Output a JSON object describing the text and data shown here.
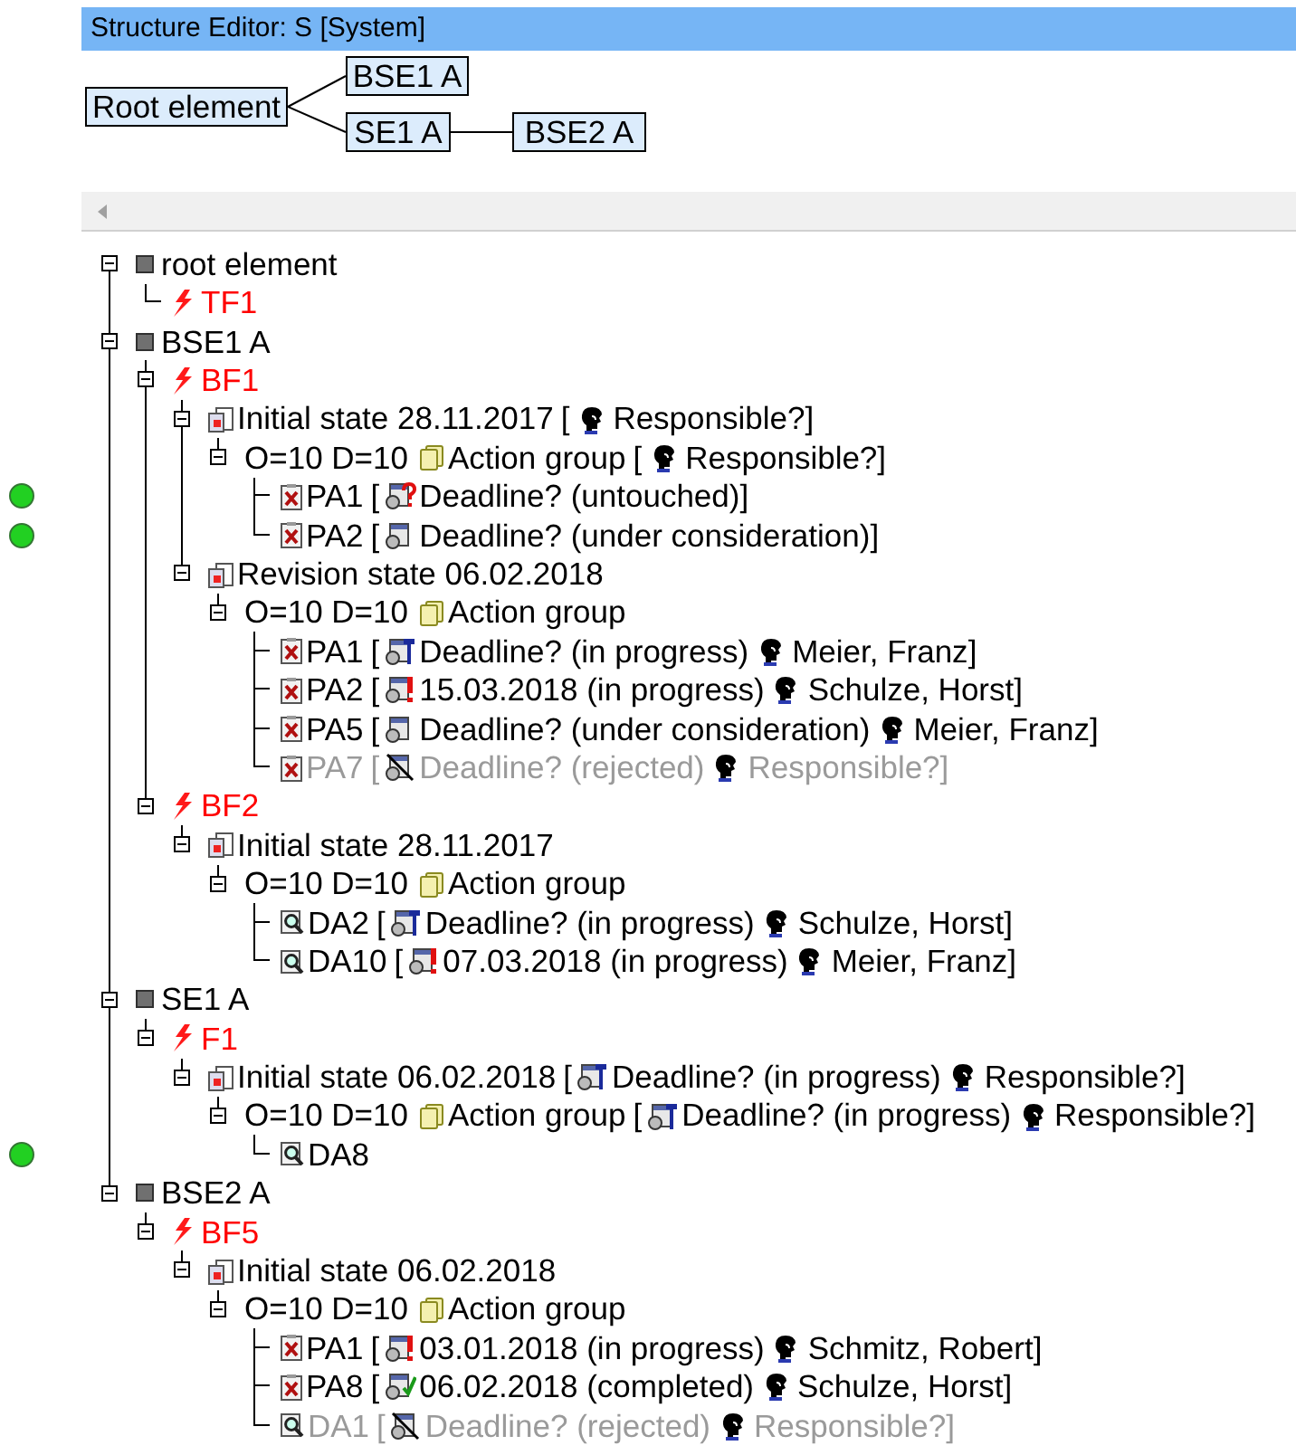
{
  "window": {
    "title": "Structure Editor: S [System]"
  },
  "diagram": {
    "nodes": [
      {
        "label": "Root element"
      },
      {
        "label": "BSE1 A"
      },
      {
        "label": "SE1 A"
      },
      {
        "label": "BSE2 A"
      }
    ]
  },
  "tree": [
    {
      "kind": "structure",
      "label": "root element",
      "expanded": true,
      "children": [
        {
          "kind": "function",
          "label": "TF1"
        }
      ]
    },
    {
      "kind": "structure",
      "label": "BSE1 A",
      "expanded": true,
      "children": [
        {
          "kind": "function",
          "label": "BF1",
          "expanded": true,
          "children": [
            {
              "kind": "state",
              "label": "Initial state 28.11.2017",
              "details": {
                "open": "[",
                "responsible": "Responsible?",
                "close": "]"
              },
              "expanded": true,
              "children": [
                {
                  "kind": "group",
                  "counts": "O=10 D=10",
                  "label": "Action group",
                  "details": {
                    "open": "[",
                    "responsible": "Responsible?",
                    "close": "]"
                  },
                  "expanded": true,
                  "children": [
                    {
                      "kind": "preventive",
                      "label": "PA1",
                      "rejected": false,
                      "flagged": true,
                      "details": {
                        "open": "[",
                        "status_icon": {
                          "kind": "question"
                        },
                        "deadline": "Deadline? (untouched)",
                        "close": "]"
                      }
                    },
                    {
                      "kind": "preventive",
                      "label": "PA2",
                      "rejected": false,
                      "flagged": true,
                      "details": {
                        "open": "[",
                        "status_icon": {
                          "kind": "plain"
                        },
                        "deadline": "Deadline? (under consideration)",
                        "close": "]"
                      }
                    }
                  ]
                }
              ]
            },
            {
              "kind": "state",
              "label": "Revision state 06.02.2018",
              "expanded": true,
              "children": [
                {
                  "kind": "group",
                  "counts": "O=10 D=10",
                  "label": "Action group",
                  "expanded": true,
                  "children": [
                    {
                      "kind": "preventive",
                      "label": "PA1",
                      "rejected": false,
                      "flagged": false,
                      "details": {
                        "open": "[",
                        "status_icon": {
                          "kind": "wrench"
                        },
                        "deadline": "Deadline? (in progress)",
                        "responsible": "Meier, Franz",
                        "close": "]"
                      }
                    },
                    {
                      "kind": "preventive",
                      "label": "PA2",
                      "rejected": false,
                      "flagged": false,
                      "details": {
                        "open": "[",
                        "status_icon": {
                          "kind": "exclamation"
                        },
                        "deadline": "15.03.2018 (in progress)",
                        "responsible": "Schulze, Horst",
                        "close": "]"
                      }
                    },
                    {
                      "kind": "preventive",
                      "label": "PA5",
                      "rejected": false,
                      "flagged": false,
                      "details": {
                        "open": "[",
                        "status_icon": {
                          "kind": "plain"
                        },
                        "deadline": "Deadline? (under consideration)",
                        "responsible": "Meier, Franz",
                        "close": "]"
                      }
                    },
                    {
                      "kind": "preventive",
                      "label": "PA7",
                      "rejected": true,
                      "flagged": false,
                      "details": {
                        "open": "[",
                        "status_icon": {
                          "kind": "crossed"
                        },
                        "deadline": "Deadline? (rejected)",
                        "responsible": "Responsible?",
                        "close": "]"
                      }
                    }
                  ]
                }
              ]
            }
          ]
        },
        {
          "kind": "function",
          "label": "BF2",
          "expanded": true,
          "children": [
            {
              "kind": "state",
              "label": "Initial state 28.11.2017",
              "expanded": true,
              "children": [
                {
                  "kind": "group",
                  "counts": "O=10 D=10",
                  "label": "Action group",
                  "expanded": true,
                  "children": [
                    {
                      "kind": "detection",
                      "label": "DA2",
                      "rejected": false,
                      "flagged": false,
                      "details": {
                        "open": "[",
                        "status_icon": {
                          "kind": "wrench"
                        },
                        "deadline": "Deadline? (in progress)",
                        "responsible": "Schulze, Horst",
                        "close": "]"
                      }
                    },
                    {
                      "kind": "detection",
                      "label": "DA10",
                      "rejected": false,
                      "flagged": false,
                      "details": {
                        "open": "[",
                        "status_icon": {
                          "kind": "exclamation"
                        },
                        "deadline": "07.03.2018 (in progress)",
                        "responsible": "Meier, Franz",
                        "close": "]"
                      }
                    }
                  ]
                }
              ]
            }
          ]
        }
      ]
    },
    {
      "kind": "structure",
      "label": "SE1 A",
      "expanded": true,
      "children": [
        {
          "kind": "function",
          "label": "F1",
          "expanded": true,
          "children": [
            {
              "kind": "state",
              "label": "Initial state 06.02.2018",
              "details": {
                "open": "[",
                "status_icon": {
                  "kind": "wrench"
                },
                "deadline": "Deadline? (in progress)",
                "responsible": "Responsible?",
                "close": "]"
              },
              "expanded": true,
              "children": [
                {
                  "kind": "group",
                  "counts": "O=10 D=10",
                  "label": "Action group",
                  "details": {
                    "open": "[",
                    "status_icon": {
                      "kind": "wrench"
                    },
                    "deadline": "Deadline? (in progress)",
                    "responsible": "Responsible?",
                    "close": "]"
                  },
                  "expanded": true,
                  "children": [
                    {
                      "kind": "detection",
                      "label": "DA8",
                      "rejected": false,
                      "flagged": true
                    }
                  ]
                }
              ]
            }
          ]
        }
      ]
    },
    {
      "kind": "structure",
      "label": "BSE2 A",
      "expanded": true,
      "children": [
        {
          "kind": "function",
          "label": "BF5",
          "expanded": true,
          "children": [
            {
              "kind": "state",
              "label": "Initial state 06.02.2018",
              "expanded": true,
              "children": [
                {
                  "kind": "group",
                  "counts": "O=10 D=10",
                  "label": "Action group",
                  "expanded": true,
                  "children": [
                    {
                      "kind": "preventive",
                      "label": "PA1",
                      "rejected": false,
                      "flagged": false,
                      "details": {
                        "open": "[",
                        "status_icon": {
                          "kind": "exclamation"
                        },
                        "deadline": "03.01.2018 (in progress)",
                        "responsible": "Schmitz, Robert",
                        "close": "]"
                      }
                    },
                    {
                      "kind": "preventive",
                      "label": "PA8",
                      "rejected": false,
                      "flagged": false,
                      "details": {
                        "open": "[",
                        "status_icon": {
                          "kind": "check"
                        },
                        "deadline": "06.02.2018 (completed)",
                        "responsible": "Schulze, Horst",
                        "close": "]"
                      }
                    },
                    {
                      "kind": "detection",
                      "label": "DA1",
                      "rejected": true,
                      "flagged": false,
                      "details": {
                        "open": "[",
                        "status_icon": {
                          "kind": "crossed"
                        },
                        "deadline": "Deadline? (rejected)",
                        "responsible": "Responsible?",
                        "close": "]"
                      }
                    }
                  ]
                }
              ]
            }
          ]
        }
      ]
    }
  ]
}
